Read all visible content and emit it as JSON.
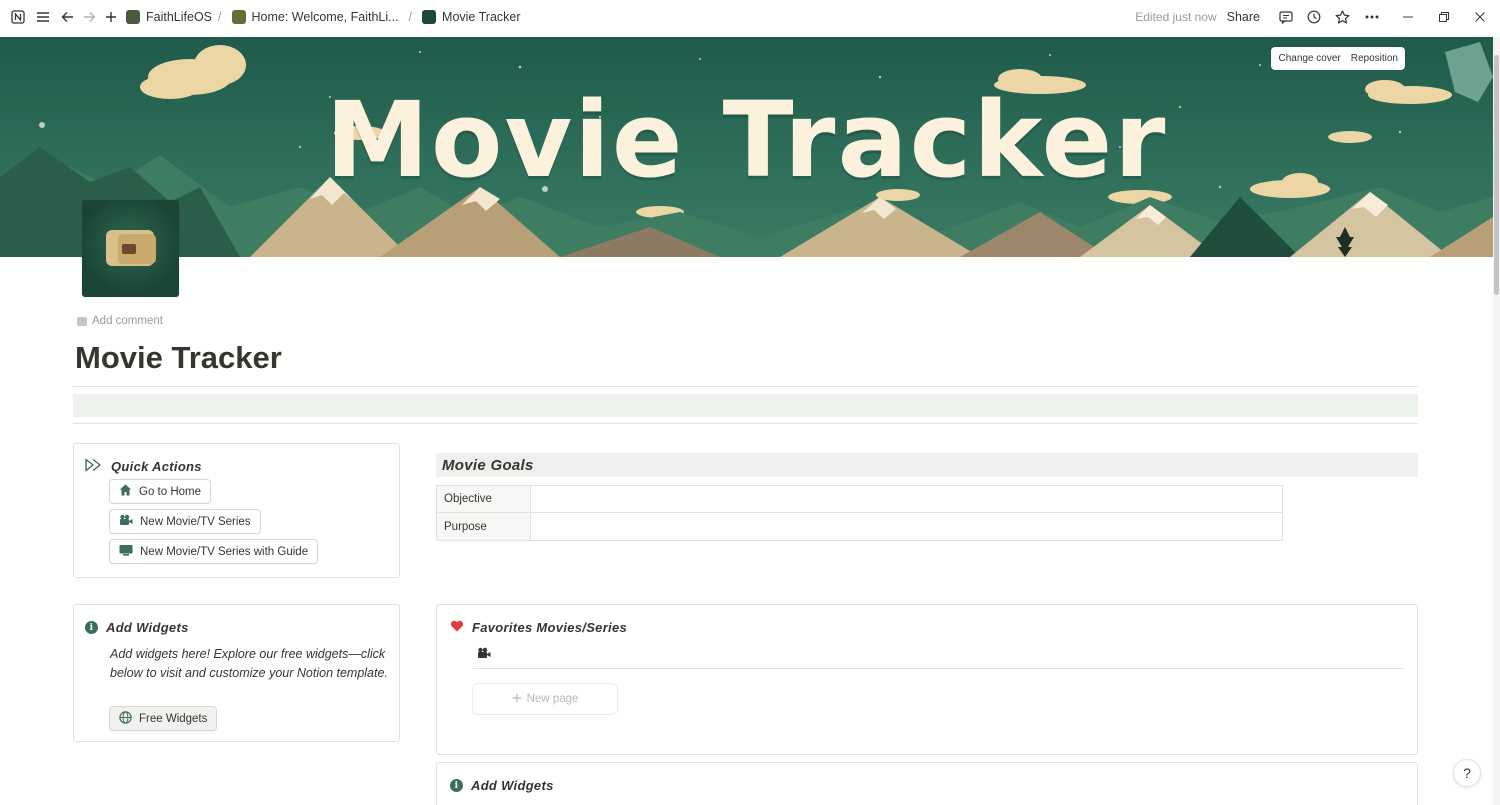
{
  "topbar": {
    "breadcrumbs": [
      {
        "label": "FaithLifeOS"
      },
      {
        "label": "Home: Welcome, FaithLi..."
      },
      {
        "label": "Movie Tracker"
      }
    ],
    "edited": "Edited just now",
    "share": "Share"
  },
  "cover": {
    "title": "Movie Tracker",
    "change_cover": "Change cover",
    "reposition": "Reposition"
  },
  "page": {
    "add_comment": "Add comment",
    "title": "Movie Tracker"
  },
  "quick_actions": {
    "title": "Quick Actions",
    "buttons": [
      {
        "label": "Go to Home",
        "icon": "home-icon"
      },
      {
        "label": "New Movie/TV Series",
        "icon": "camera-icon"
      },
      {
        "label": "New Movie/TV Series with Guide",
        "icon": "tv-icon"
      }
    ]
  },
  "goals": {
    "title": "Movie Goals",
    "rows": [
      {
        "label": "Objective",
        "value": ""
      },
      {
        "label": "Purpose",
        "value": ""
      }
    ]
  },
  "add_widgets": {
    "title": "Add Widgets",
    "text": "Add widgets here! Explore our free widgets—click below to visit and customize your Notion template.",
    "button": "Free Widgets"
  },
  "favorites": {
    "title": "Favorites Movies/Series",
    "new_page": "New page"
  },
  "add_widgets_2": {
    "title": "Add Widgets"
  },
  "help": "?",
  "colors": {
    "accent_green": "#3d6e57",
    "heart": "#e03e3e",
    "band": "#edf2ec"
  }
}
